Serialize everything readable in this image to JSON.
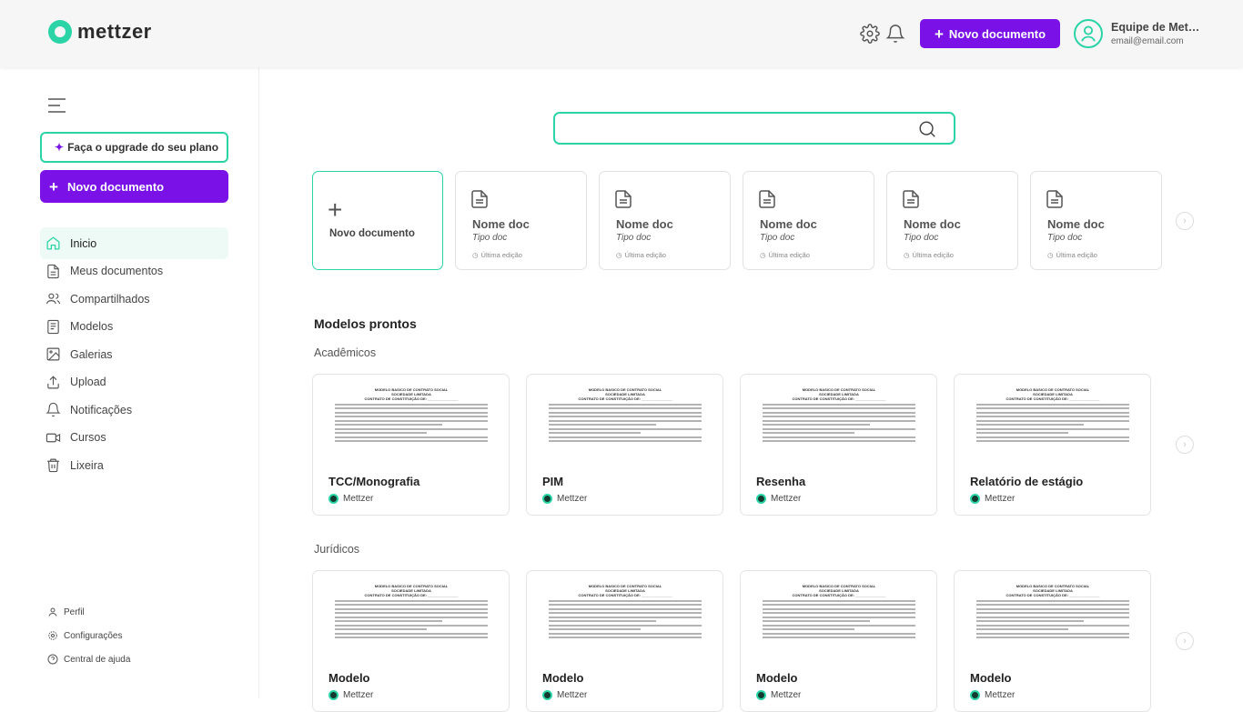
{
  "header": {
    "logo_text": "mettzer",
    "new_doc_label": "Novo documento",
    "user_name": "Equipe de Mettzer",
    "user_email": "email@email.com"
  },
  "sidebar": {
    "upgrade_label": "Faça o upgrade do seu plano",
    "new_doc_label": "Novo documento",
    "items": [
      {
        "label": "Inicio",
        "icon": "home-icon"
      },
      {
        "label": "Meus documentos",
        "icon": "document-icon"
      },
      {
        "label": "Compartilhados",
        "icon": "users-icon"
      },
      {
        "label": "Modelos",
        "icon": "template-icon"
      },
      {
        "label": "Galerias",
        "icon": "image-icon"
      },
      {
        "label": "Upload",
        "icon": "upload-icon"
      },
      {
        "label": "Notificações",
        "icon": "bell-icon"
      },
      {
        "label": "Cursos",
        "icon": "video-icon"
      },
      {
        "label": "Lixeira",
        "icon": "trash-icon"
      }
    ],
    "footer": [
      {
        "label": "Perfil",
        "icon": "user-icon"
      },
      {
        "label": "Configurações",
        "icon": "gear-icon"
      },
      {
        "label": "Central de ajuda",
        "icon": "help-icon"
      }
    ]
  },
  "search": {
    "placeholder": ""
  },
  "recent": {
    "new_doc_label": "Novo documento",
    "docs": [
      {
        "name": "Nome doc",
        "type": "Tipo doc",
        "edited": "Última edição"
      },
      {
        "name": "Nome doc",
        "type": "Tipo doc",
        "edited": "Última edição"
      },
      {
        "name": "Nome doc",
        "type": "Tipo doc",
        "edited": "Última edição"
      },
      {
        "name": "Nome doc",
        "type": "Tipo doc",
        "edited": "Última edição"
      },
      {
        "name": "Nome doc",
        "type": "Tipo doc",
        "edited": "Última edição"
      }
    ]
  },
  "templates": {
    "title": "Modelos prontos",
    "preview_title": "MODELO BASICO DE CONTRATO SOCIAL",
    "preview_subtitle": "SOCIEDADE LIMITADA",
    "preview_line": "CONTRATO DE CONSTITUIÇÃO DE: _______________",
    "academic": {
      "label": "Acadêmicos",
      "items": [
        {
          "name": "TCC/Monografia",
          "author": "Mettzer"
        },
        {
          "name": "PIM",
          "author": "Mettzer"
        },
        {
          "name": "Resenha",
          "author": "Mettzer"
        },
        {
          "name": "Relatório de estágio",
          "author": "Mettzer"
        }
      ]
    },
    "legal": {
      "label": "Jurídicos",
      "items": [
        {
          "name": "Modelo",
          "author": "Mettzer"
        },
        {
          "name": "Modelo",
          "author": "Mettzer"
        },
        {
          "name": "Modelo",
          "author": "Mettzer"
        },
        {
          "name": "Modelo",
          "author": "Mettzer"
        }
      ]
    }
  },
  "colors": {
    "accent": "#2ad4a6",
    "primary": "#7a12e8"
  }
}
